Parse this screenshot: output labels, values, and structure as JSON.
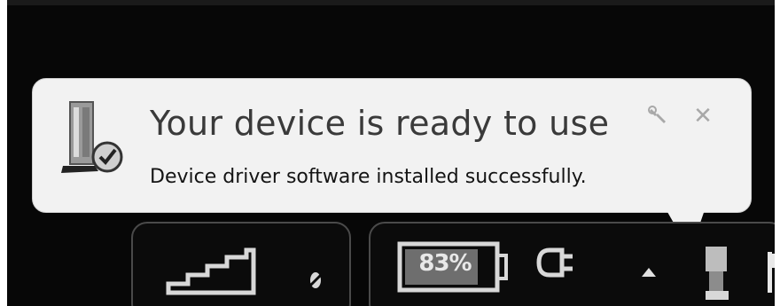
{
  "notification": {
    "title": "Your device is ready to use",
    "message": "Device driver software installed successfully.",
    "close_glyph": "✕",
    "icons": {
      "device": "device-check-icon",
      "options": "wrench-icon",
      "close": "close-icon"
    }
  },
  "tray": {
    "battery_percent": "83%",
    "battery_level": 0.83,
    "icons": [
      "signal-strength-icon",
      "network-status-icon",
      "battery-icon",
      "power-plug-icon",
      "show-hidden-icons-arrow",
      "usb-device-icon",
      "action-center-flag-icon"
    ]
  },
  "colors": {
    "balloon_bg": "#f2f2f2",
    "taskbar_bg": "#070707",
    "title_text": "#3a3a3a"
  }
}
